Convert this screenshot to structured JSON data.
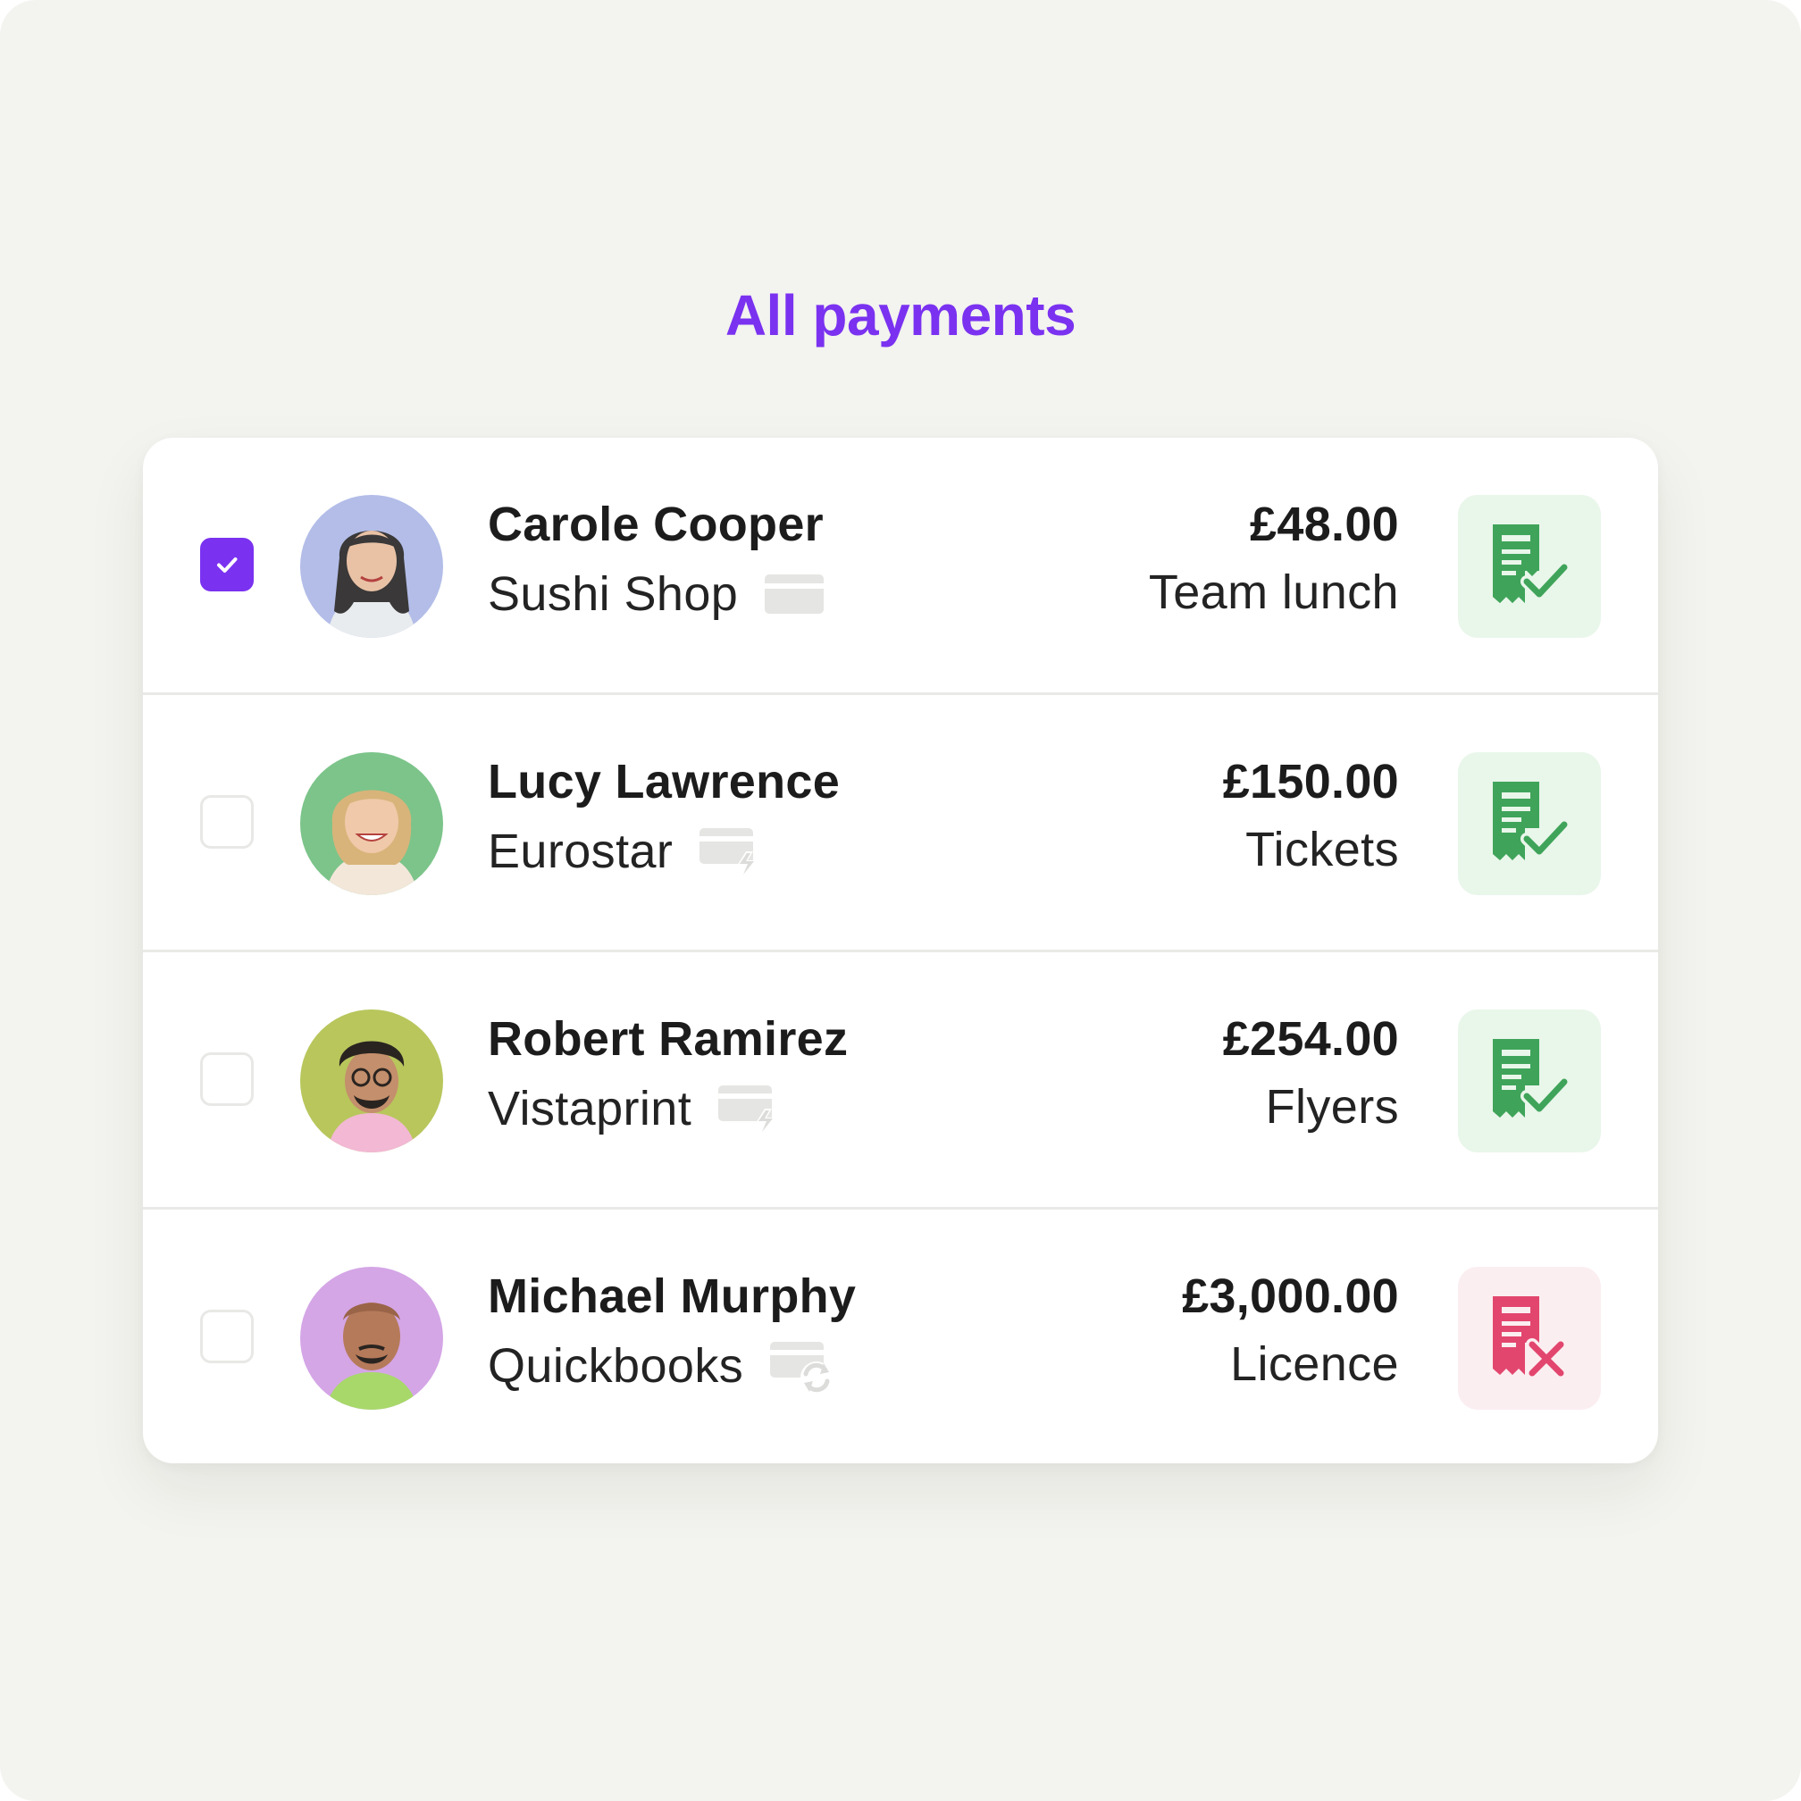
{
  "page": {
    "title": "All payments",
    "accent_color": "#7a32f0",
    "background_color": "#f3f3ef"
  },
  "payments": [
    {
      "selected": true,
      "name": "Carole Cooper",
      "merchant": "Sushi Shop",
      "payment_icon": "card-icon",
      "amount": "£48.00",
      "description": "Team lunch",
      "receipt_status": "receipt-approved-icon",
      "avatar_color": "#b3bde8"
    },
    {
      "selected": false,
      "name": "Lucy Lawrence",
      "merchant": "Eurostar",
      "payment_icon": "instant-card-icon",
      "amount": "£150.00",
      "description": "Tickets",
      "receipt_status": "receipt-approved-icon",
      "avatar_color": "#7cc48a"
    },
    {
      "selected": false,
      "name": "Robert Ramirez",
      "merchant": "Vistaprint",
      "payment_icon": "instant-card-icon",
      "amount": "£254.00",
      "description": "Flyers",
      "receipt_status": "receipt-approved-icon",
      "avatar_color": "#b8c65c"
    },
    {
      "selected": false,
      "name": "Michael Murphy",
      "merchant": "Quickbooks",
      "payment_icon": "recurring-card-icon",
      "amount": "£3,000.00",
      "description": "Licence",
      "receipt_status": "receipt-missing-icon",
      "avatar_color": "#d4a6e6"
    }
  ],
  "status_colors": {
    "approved_bg": "#e9f6ea",
    "approved_icon": "#3fa45a",
    "missing_bg": "#fbeef1",
    "missing_icon": "#e2466e"
  }
}
